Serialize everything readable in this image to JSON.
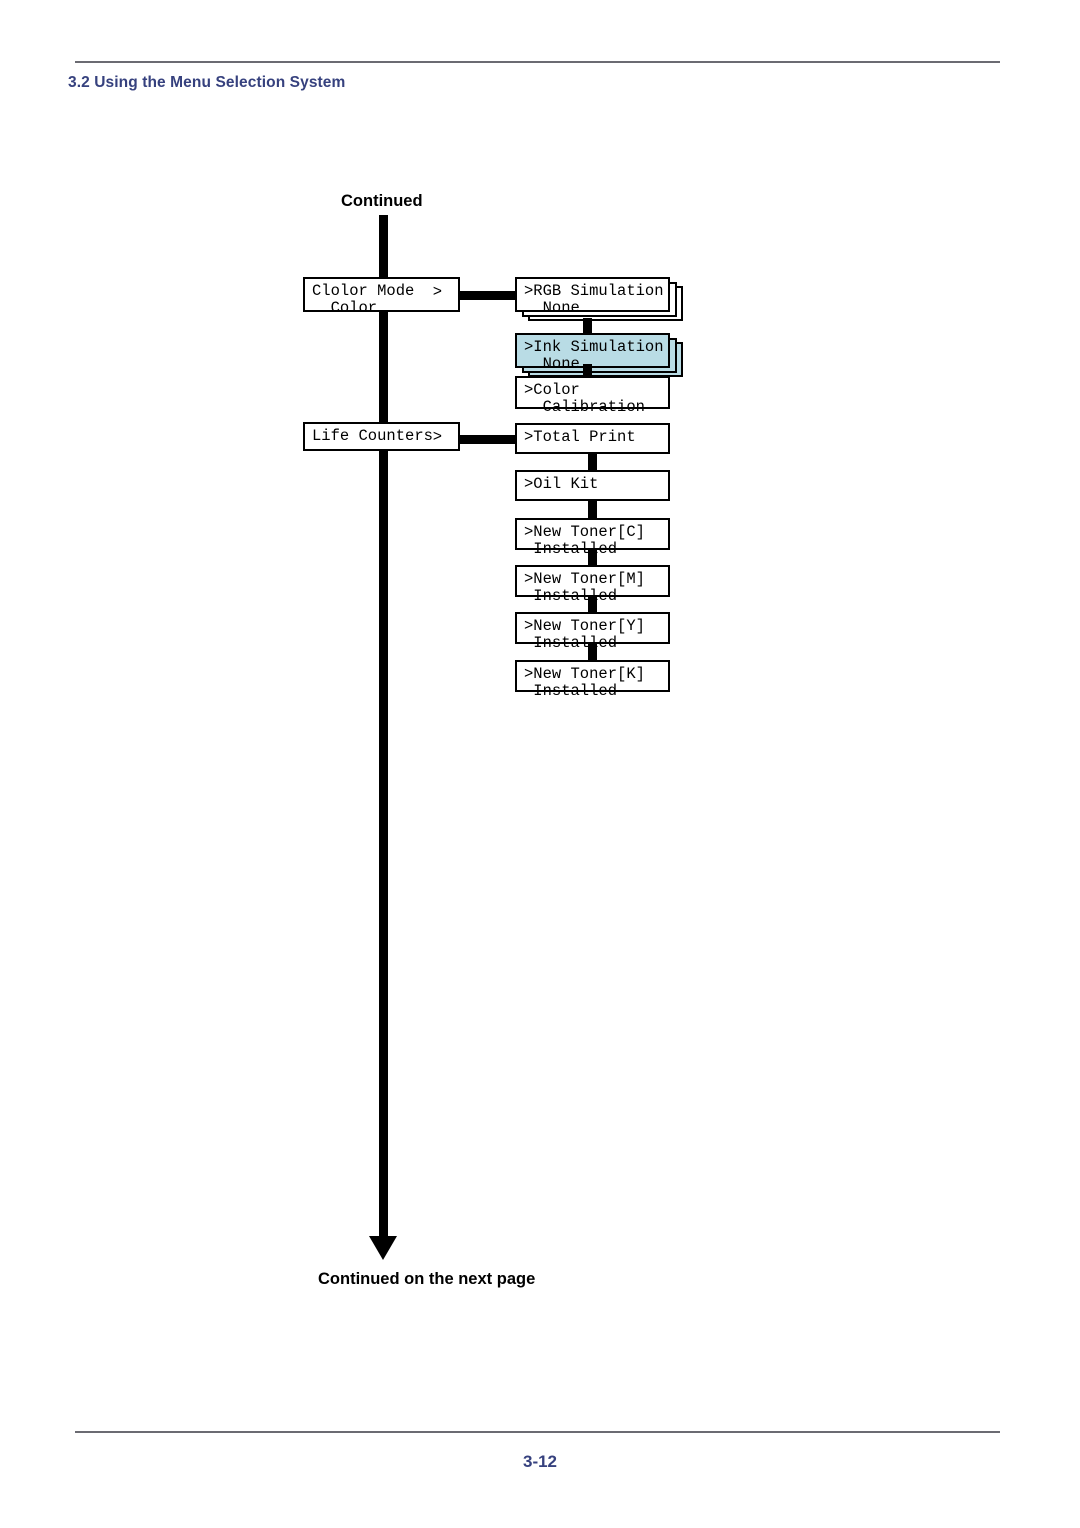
{
  "page": {
    "section_header": "3.2 Using the Menu Selection System",
    "page_number": "3-12",
    "caption_top": "Continued",
    "caption_bottom": "Continued on the next page"
  },
  "theme": {
    "accent_navy": "#36417e",
    "rule_gray": "#6b6b72",
    "highlight_blue": "#b9dce5",
    "ink_black": "#000000",
    "paper_white": "#ffffff"
  },
  "diagram": {
    "type": "menu-tree",
    "trunk_label": "menu-spine",
    "menu_items": [
      {
        "id": "color-mode",
        "line1": "Clolor Mode",
        "line2": "  Color",
        "arrow": ">",
        "has_submenu": true,
        "highlighted": false,
        "stacked": false
      },
      {
        "id": "life-counters",
        "line1": "Life Counters",
        "line2": "",
        "arrow": ">",
        "has_submenu": true,
        "highlighted": false,
        "stacked": false
      }
    ],
    "submenu_color_mode": [
      {
        "id": "rgb-simulation",
        "line1": ">RGB Simulation",
        "line2": "  None",
        "highlighted": false,
        "stacked": true
      },
      {
        "id": "ink-simulation",
        "line1": ">Ink Simulation",
        "line2": "  None",
        "highlighted": true,
        "stacked": true
      },
      {
        "id": "color-calibration",
        "line1": ">Color",
        "line2": "  Calibration",
        "highlighted": false,
        "stacked": false
      }
    ],
    "submenu_life_counters": [
      {
        "id": "total-print",
        "line1": ">Total Print",
        "line2": "",
        "highlighted": false,
        "stacked": false
      },
      {
        "id": "oil-kit",
        "line1": ">Oil Kit",
        "line2": "",
        "highlighted": false,
        "stacked": false
      },
      {
        "id": "new-toner-c",
        "line1": ">New Toner[C]",
        "line2": " Installed",
        "highlighted": false,
        "stacked": false
      },
      {
        "id": "new-toner-m",
        "line1": ">New Toner[M]",
        "line2": " Installed",
        "highlighted": false,
        "stacked": false
      },
      {
        "id": "new-toner-y",
        "line1": ">New Toner[Y]",
        "line2": " Installed",
        "highlighted": false,
        "stacked": false
      },
      {
        "id": "new-toner-k",
        "line1": ">New Toner[K]",
        "line2": " Installed",
        "highlighted": false,
        "stacked": false
      }
    ]
  }
}
